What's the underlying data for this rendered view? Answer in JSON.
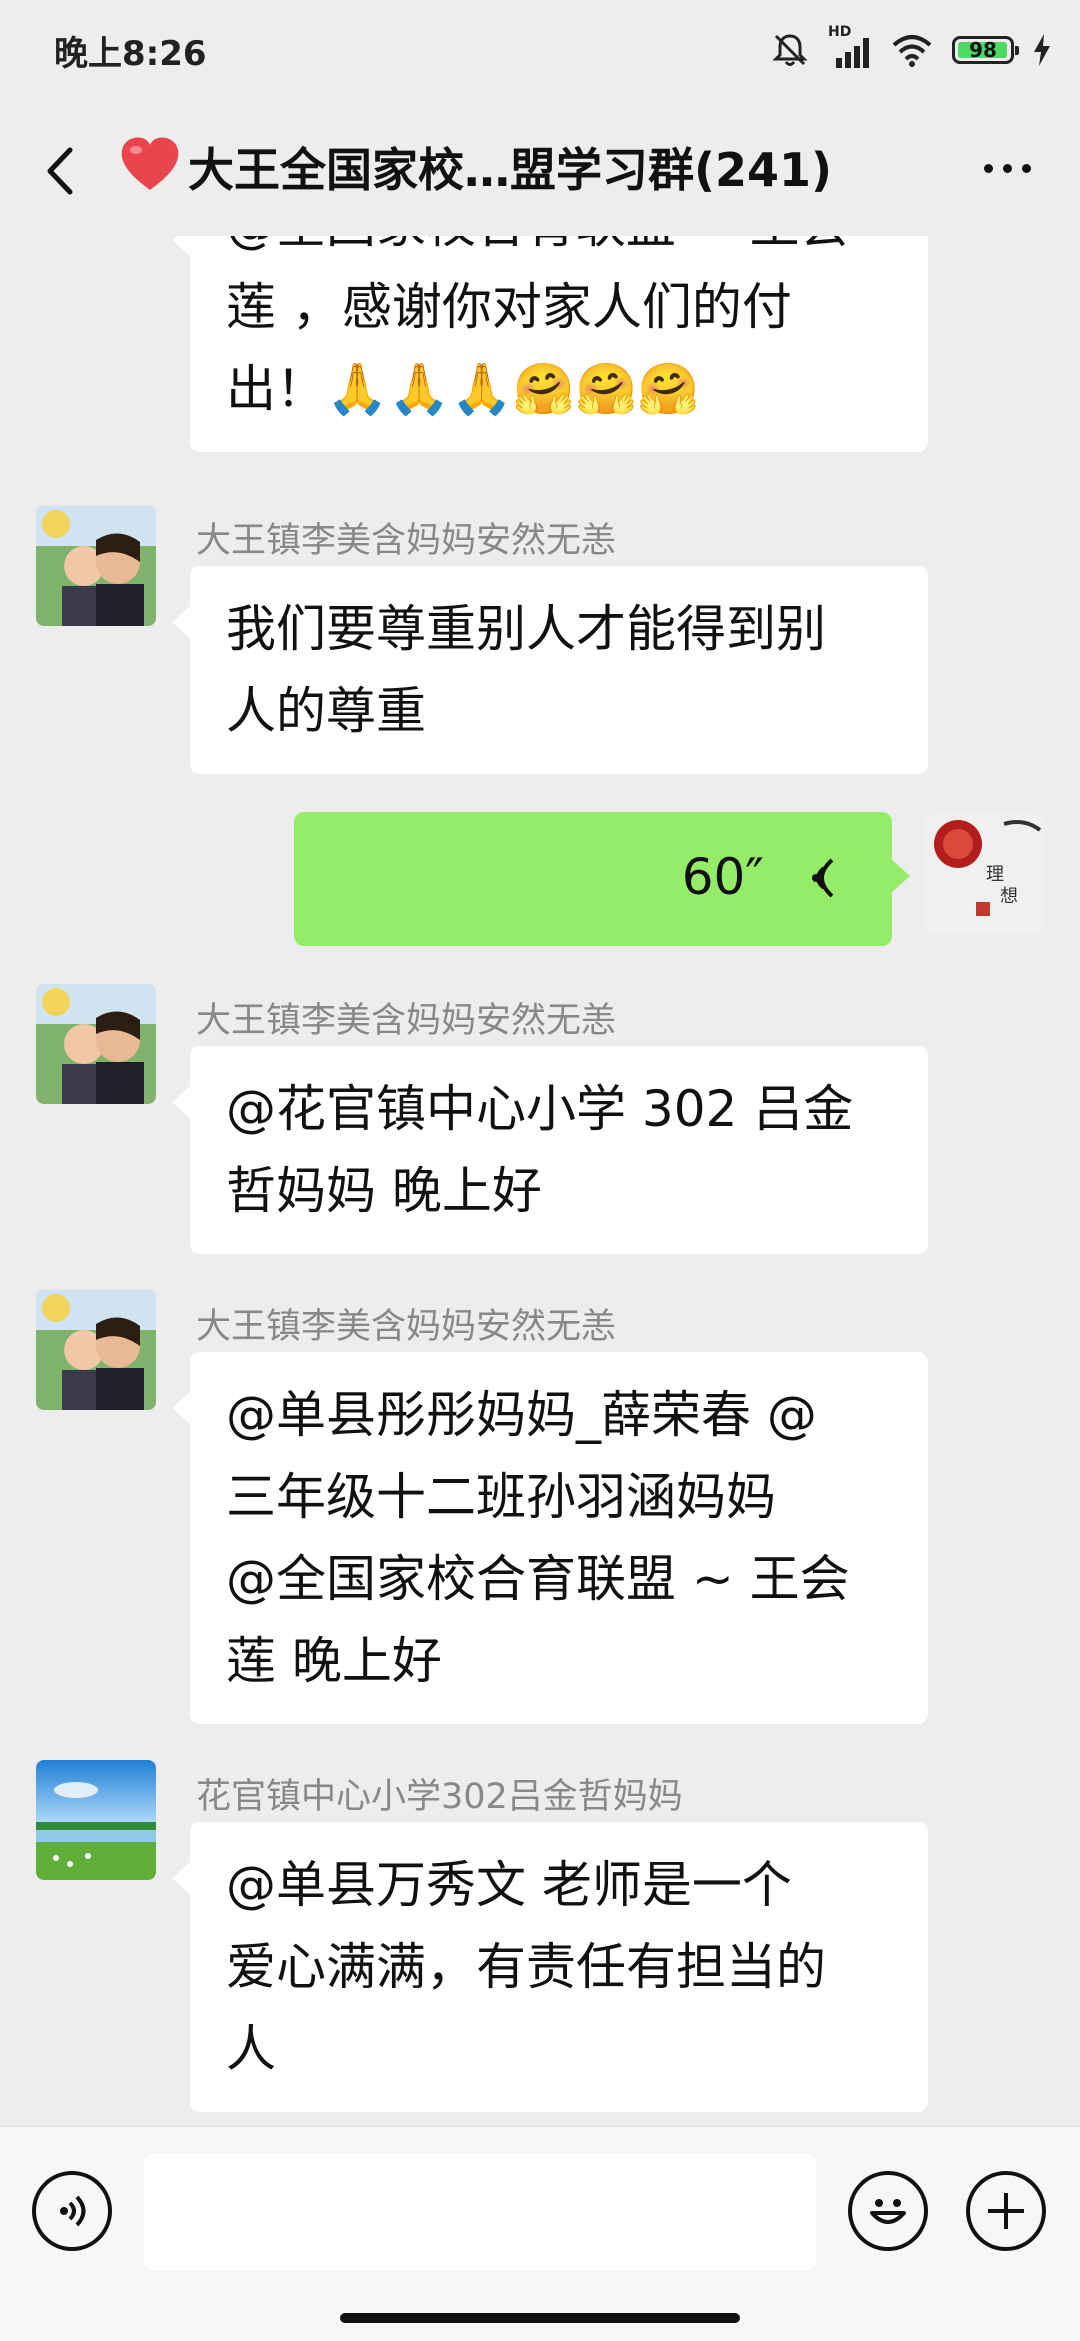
{
  "status_bar": {
    "time": "晚上8:26",
    "network": "HD",
    "battery": "98"
  },
  "header": {
    "title": "大王全国家校…盟学习群(241)",
    "heart_icon": "red-heart-icon",
    "back_icon": "back-chevron-icon",
    "more_icon": "more-dots-icon"
  },
  "messages": [
    {
      "type": "text",
      "side": "left",
      "lines": [
        "@全国家校合育联盟 ~ 王会",
        "莲 ，感谢你对家人们的付",
        "出！🙏🙏🙏🤗🤗🤗"
      ]
    },
    {
      "type": "text",
      "side": "left",
      "sender": "大王镇李美含妈妈安然无恙",
      "lines": [
        "我们要尊重别人才能得到别",
        "人的尊重"
      ]
    },
    {
      "type": "voice",
      "side": "right",
      "duration": "60″"
    },
    {
      "type": "text",
      "side": "left",
      "sender": "大王镇李美含妈妈安然无恙",
      "lines": [
        "@花官镇中心小学 302 吕金",
        "哲妈妈  晚上好"
      ]
    },
    {
      "type": "text",
      "side": "left",
      "sender": "大王镇李美含妈妈安然无恙",
      "lines": [
        "@单县彤彤妈妈_薛荣春  @",
        "三年级十二班孙羽涵妈妈",
        "@全国家校合育联盟 ~ 王会",
        "莲  晚上好"
      ]
    },
    {
      "type": "text",
      "side": "left",
      "sender": "花官镇中心小学302吕金哲妈妈",
      "lines": [
        "@单县万秀文  老师是一个",
        "爱心满满，有责任有担当的",
        "人"
      ]
    }
  ],
  "input_bar": {
    "voice_icon": "voice-input-icon",
    "emoji_icon": "emoji-icon",
    "plus_icon": "add-icon",
    "text_value": ""
  },
  "colors": {
    "background": "#ededed",
    "self_bubble": "#95ec69",
    "other_bubble": "#ffffff",
    "name_gray": "#888888"
  }
}
